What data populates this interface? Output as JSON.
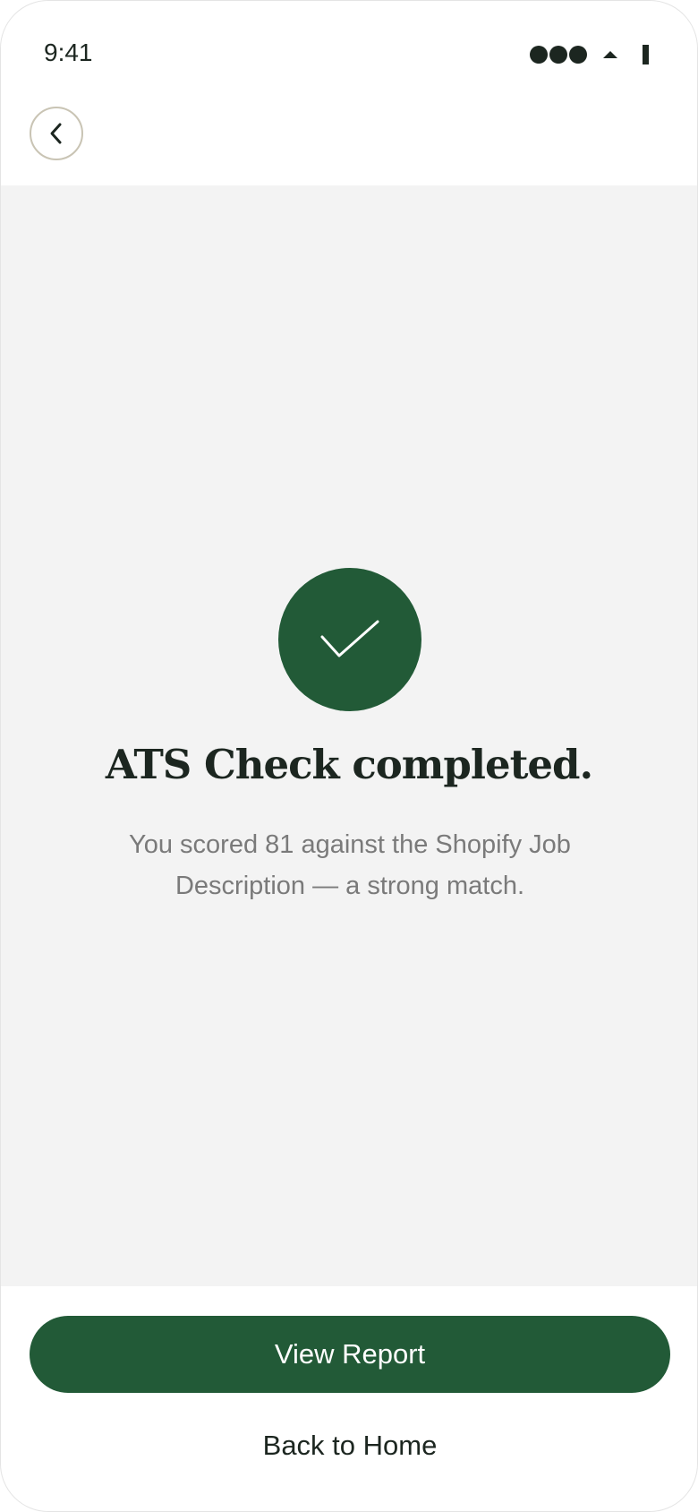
{
  "status_bar": {
    "time": "9:41",
    "icons": [
      "cellular-dots-icon",
      "wifi-icon",
      "battery-icon"
    ]
  },
  "nav": {
    "back_icon": "chevron-left-icon"
  },
  "result": {
    "icon": "checkmark-icon",
    "title": "ATS Check completed.",
    "description": "You scored 81 against the Shopify Job Description — a strong match."
  },
  "actions": {
    "primary_label": "View Report",
    "secondary_label": "Back to Home"
  },
  "colors": {
    "accent": "#225a37",
    "text": "#1c2620",
    "muted_text": "#7a7a7a",
    "content_bg": "#f3f3f3"
  }
}
